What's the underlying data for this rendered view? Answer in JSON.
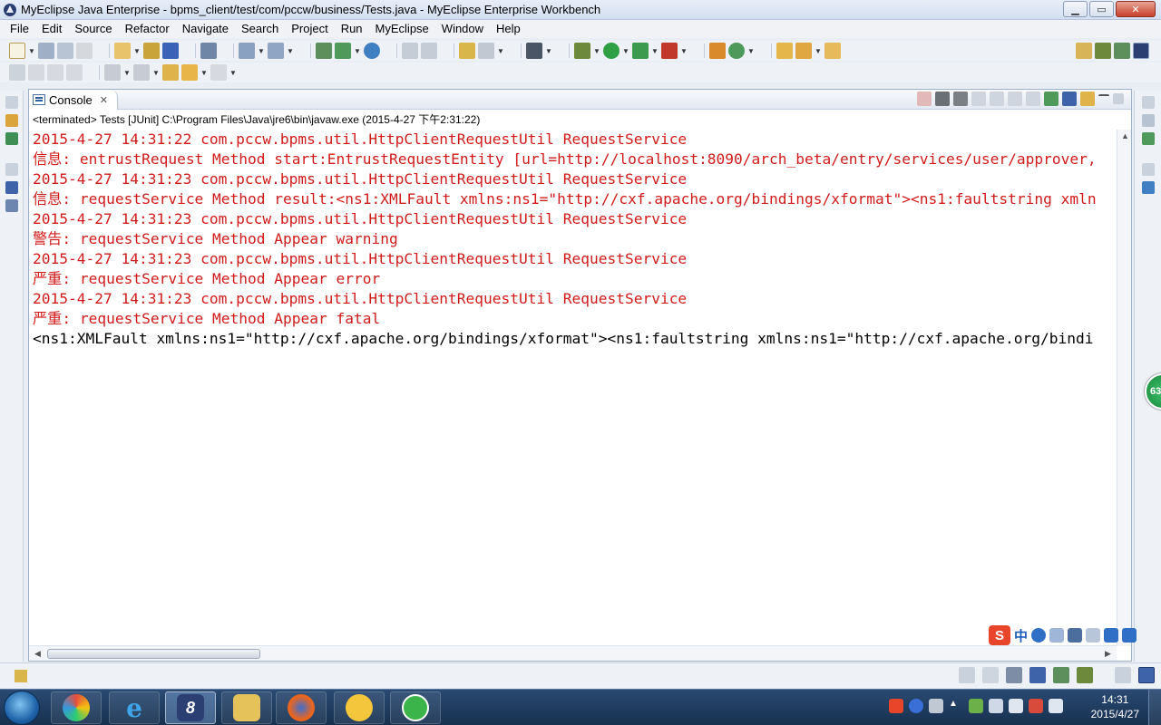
{
  "window": {
    "title": "MyEclipse Java Enterprise - bpms_client/test/com/pccw/business/Tests.java - MyEclipse Enterprise Workbench"
  },
  "menu": [
    "File",
    "Edit",
    "Source",
    "Refactor",
    "Navigate",
    "Search",
    "Project",
    "Run",
    "MyEclipse",
    "Window",
    "Help"
  ],
  "console": {
    "tab_label": "Console",
    "tab_close": "✕",
    "status": "<terminated> Tests [JUnit] C:\\Program Files\\Java\\jre6\\bin\\javaw.exe (2015-4-27 下午2:31:22)",
    "lines": [
      {
        "text": "2015-4-27 14:31:22 com.pccw.bpms.util.HttpClientRequestUtil RequestService",
        "stream": "err"
      },
      {
        "text": "信息: entrustRequest Method start:EntrustRequestEntity [url=http://localhost:8090/arch_beta/entry/services/user/approver,",
        "stream": "err"
      },
      {
        "text": "2015-4-27 14:31:23 com.pccw.bpms.util.HttpClientRequestUtil RequestService",
        "stream": "err"
      },
      {
        "text": "信息: requestService Method result:<ns1:XMLFault xmlns:ns1=\"http://cxf.apache.org/bindings/xformat\"><ns1:faultstring xmln",
        "stream": "err"
      },
      {
        "text": "2015-4-27 14:31:23 com.pccw.bpms.util.HttpClientRequestUtil RequestService",
        "stream": "err"
      },
      {
        "text": "警告: requestService Method Appear warning",
        "stream": "err"
      },
      {
        "text": "2015-4-27 14:31:23 com.pccw.bpms.util.HttpClientRequestUtil RequestService",
        "stream": "err"
      },
      {
        "text": "严重: requestService Method Appear error",
        "stream": "err"
      },
      {
        "text": "2015-4-27 14:31:23 com.pccw.bpms.util.HttpClientRequestUtil RequestService",
        "stream": "err"
      },
      {
        "text": "严重: requestService Method Appear fatal",
        "stream": "err"
      },
      {
        "text": "<ns1:XMLFault xmlns:ns1=\"http://cxf.apache.org/bindings/xformat\"><ns1:faultstring xmlns:ns1=\"http://cxf.apache.org/bindi",
        "stream": "out"
      }
    ]
  },
  "ime": {
    "logo": "S",
    "mode": "中"
  },
  "badge": {
    "value": "63"
  },
  "taskbar": {
    "clock_time": "14:31",
    "clock_date": "2015/4/27",
    "tasks": [
      {
        "name": "task-pinwheel-app",
        "icon": "pinwheel-icon"
      },
      {
        "name": "task-internet-explorer",
        "icon": "internet-explorer-icon"
      },
      {
        "name": "task-myeclipse",
        "icon": "myeclipse-icon"
      },
      {
        "name": "task-file-explorer",
        "icon": "folder-icon"
      },
      {
        "name": "task-firefox",
        "icon": "firefox-icon"
      },
      {
        "name": "task-chat-app",
        "icon": "chat-icon"
      },
      {
        "name": "task-green-app",
        "icon": "green-circle-icon"
      }
    ]
  },
  "colors": {
    "stderr": "#d11b1b",
    "stdout": "#000000",
    "taskbar": "#1f3a5c"
  }
}
